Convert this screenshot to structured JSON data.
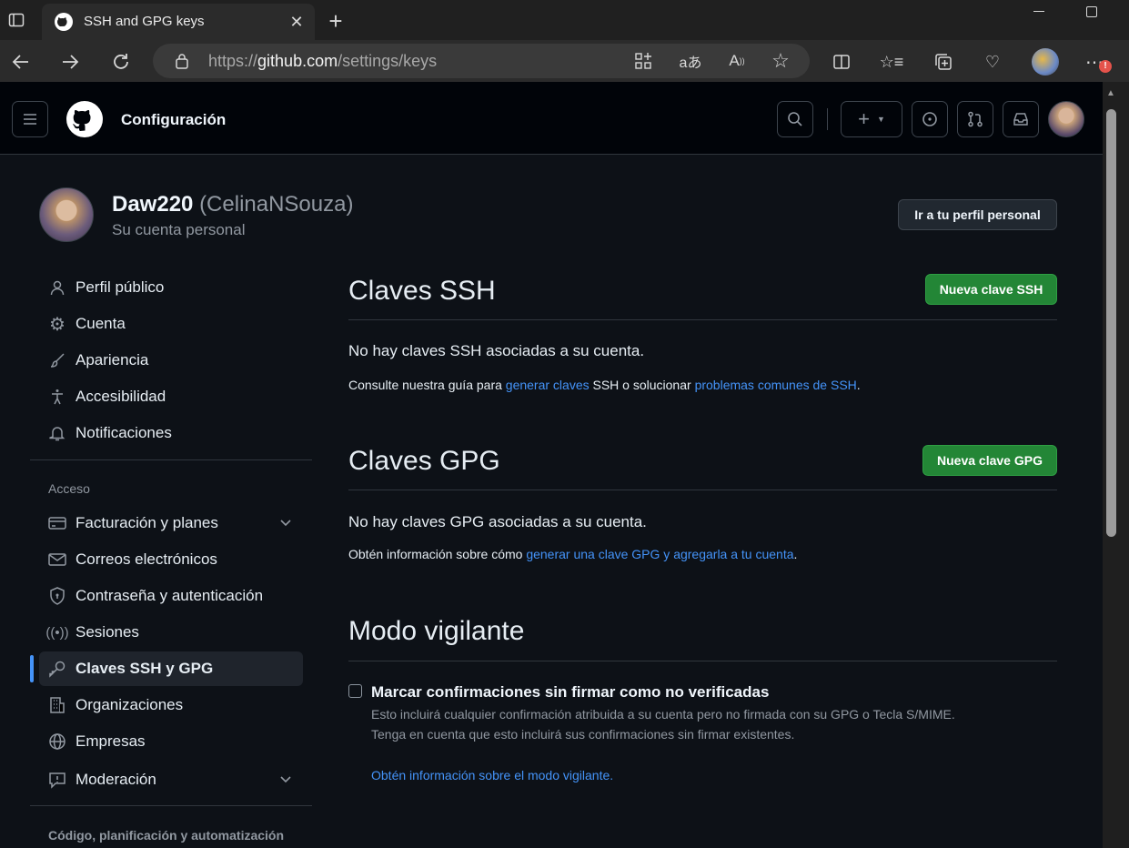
{
  "browser": {
    "tab_title": "SSH and GPG keys",
    "url_prefix": "https://",
    "url_domain": "github.com",
    "url_path": "/settings/keys"
  },
  "header": {
    "title": "Configuración"
  },
  "profile": {
    "username": "Daw220",
    "name": "(CelinaNSouza)",
    "subtitle": "Su cuenta personal",
    "go_profile_button": "Ir a tu perfil personal"
  },
  "sidebar": {
    "items_top": [
      {
        "label": "Perfil público",
        "icon": "person-icon"
      },
      {
        "label": "Cuenta",
        "icon": "gear-icon"
      },
      {
        "label": "Apariencia",
        "icon": "paintbrush-icon"
      },
      {
        "label": "Accesibilidad",
        "icon": "accessibility-icon"
      },
      {
        "label": "Notificaciones",
        "icon": "bell-icon"
      }
    ],
    "access_label": "Acceso",
    "items_access": [
      {
        "label": "Facturación y planes",
        "icon": "credit-card-icon"
      },
      {
        "label": "Correos electrónicos",
        "icon": "mail-icon"
      },
      {
        "label": "Contraseña y autenticación",
        "icon": "shield-lock-icon"
      },
      {
        "label": "Sesiones",
        "icon": "broadcast-icon"
      },
      {
        "label": "Claves SSH y GPG",
        "icon": "key-icon"
      },
      {
        "label": "Organizaciones",
        "icon": "organization-icon"
      },
      {
        "label": "Empresas",
        "icon": "globe-icon"
      },
      {
        "label": "Moderación",
        "icon": "report-icon"
      }
    ],
    "code_label": "Código, planificación y automatización"
  },
  "ssh": {
    "heading": "Claves SSH",
    "new_button": "Nueva clave SSH",
    "empty": "No hay claves SSH asociadas a su cuenta.",
    "help_1": "Consulte nuestra guía para ",
    "help_link_1": "generar claves",
    "help_2": " SSH o solucionar ",
    "help_link_2": "problemas comunes de SSH",
    "help_3": "."
  },
  "gpg": {
    "heading": "Claves GPG",
    "new_button": "Nueva clave GPG",
    "empty": "No hay claves GPG asociadas a su cuenta.",
    "help_1": "Obtén información sobre cómo ",
    "help_link": "generar una clave GPG y agregarla a tu cuenta",
    "help_2": "."
  },
  "vigilant": {
    "heading": "Modo vigilante",
    "checkbox_label": "Marcar confirmaciones sin firmar como no verificadas",
    "desc_1": "Esto incluirá cualquier confirmación atribuida a su cuenta pero no firmada con su GPG o Tecla S/MIME.",
    "desc_2": "Tenga en cuenta que esto incluirá sus confirmaciones sin firmar existentes.",
    "link": "Obtén información sobre el modo vigilante."
  }
}
